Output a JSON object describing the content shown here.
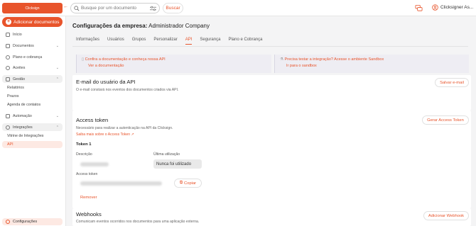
{
  "topbar": {
    "logo_text": "Clicksign",
    "search_placeholder": "Busque por um documento",
    "search_button": "Buscar",
    "user_name": "Clicksigner As..."
  },
  "sidebar": {
    "add_document": "Adicionar documentos",
    "items": [
      {
        "label": "Início",
        "icon": "home-icon"
      },
      {
        "label": "Documentos",
        "icon": "document-icon"
      },
      {
        "label": "Plano e cobrança",
        "icon": "search-icon"
      },
      {
        "label": "Aceites",
        "icon": "check-circle-icon"
      },
      {
        "label": "Gestão",
        "icon": "briefcase-icon"
      },
      {
        "label": "Automação",
        "icon": "automation-icon"
      },
      {
        "label": "Integrações",
        "icon": "integration-icon"
      }
    ],
    "gestao_sub": [
      "Relatórios",
      "Prazos",
      "Agenda de contatos"
    ],
    "integracoes_sub": [
      "Vitrine de Integrações",
      "API"
    ],
    "config": "Configurações"
  },
  "main": {
    "title_prefix": "Configurações da empresa:",
    "title_company": "Administrador Company",
    "tabs": [
      "Informações",
      "Usuários",
      "Grupos",
      "Personalizar",
      "API",
      "Segurança",
      "Plano e Cobrança"
    ],
    "info_left": {
      "text": "Confira a documentação e conheça nossa API",
      "link": "Ver a documentação"
    },
    "info_right": {
      "text": "Precisa testar a integração? Acesse o ambiente Sandbox",
      "link": "Ir para o sandbox"
    },
    "email_section": {
      "title": "E-mail do usuário da API",
      "desc": "O e-mail constará nos eventos dos documentos criados via API.",
      "button": "Salvar e-mail"
    },
    "token_section": {
      "title": "Access token",
      "desc": "Necessário para realizar a autenticação na API da Clicksign.",
      "link": "Saiba mais sobre o Access Token",
      "button": "Gerar Access Token",
      "token_title": "Token 1",
      "desc_label": "Descrição",
      "last_use_label": "Última utilização",
      "last_use_value": "Nunca foi utilizado",
      "access_label": "Access token",
      "copy": "Copiar",
      "remove": "Remover"
    },
    "webhooks_section": {
      "title": "Webhooks",
      "desc": "Comunicam eventos ocorridos nos documentos para uma aplicação externa.",
      "button": "Adicionar Webhook"
    }
  },
  "colors": {
    "accent": "#e8542b",
    "active_bg": "#fde9e3"
  }
}
